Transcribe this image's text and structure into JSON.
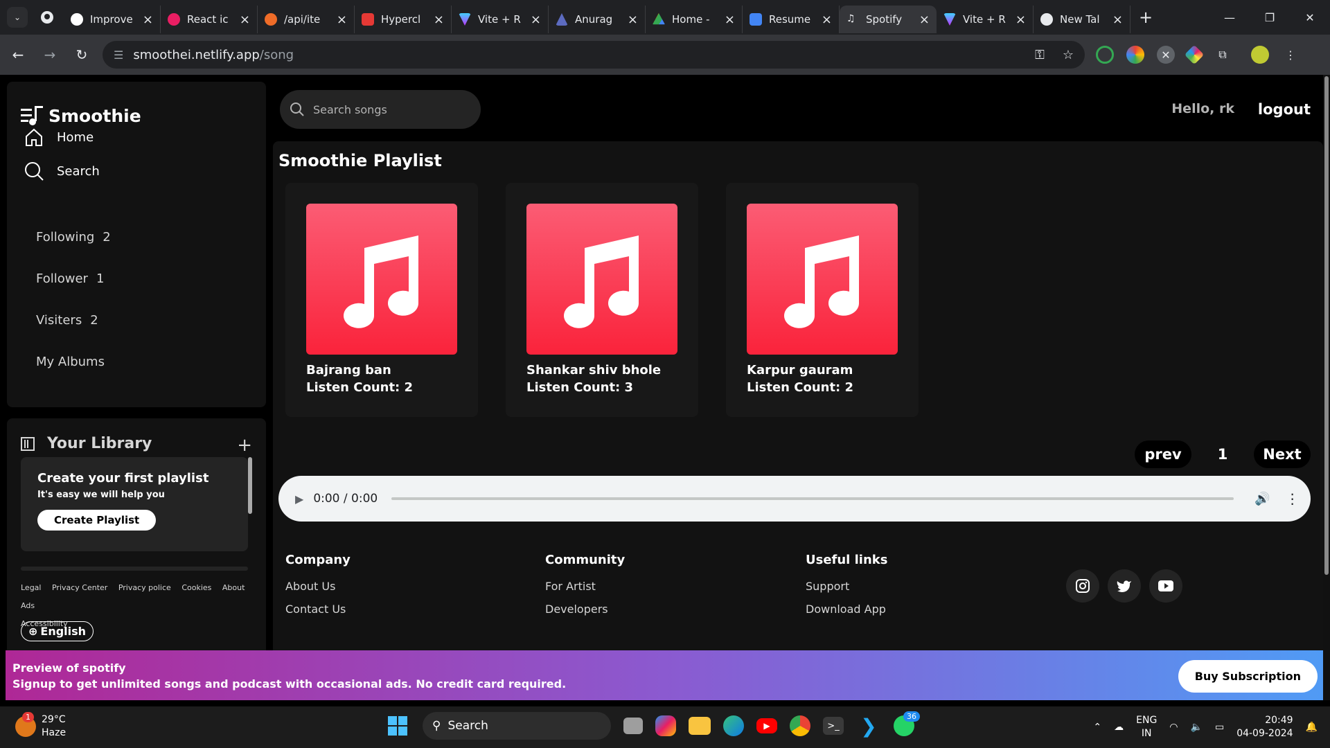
{
  "browser": {
    "tabs": [
      {
        "label": "Improve",
        "color": "#ffffff"
      },
      {
        "label": "React ic",
        "color": "#e91e63"
      },
      {
        "label": "/api/ite",
        "color": "#ef6c28"
      },
      {
        "label": "Hypercl",
        "color": "#e53935"
      },
      {
        "label": "Vite + R",
        "color": "#a56bff"
      },
      {
        "label": "Anurag",
        "color": "#5c6bc0"
      },
      {
        "label": "Home -",
        "color": "#34a853"
      },
      {
        "label": "Resume",
        "color": "#4285f4"
      },
      {
        "label": "Spotify",
        "color": "#e8eaed",
        "active": true
      },
      {
        "label": "Vite + R",
        "color": "#a56bff"
      },
      {
        "label": "New Tal",
        "color": "#e8eaed"
      }
    ],
    "url_host": "smoothei.netlify.app",
    "url_path": "/song"
  },
  "sidebar": {
    "brand": "Smoothie",
    "nav": {
      "home": "Home",
      "search": "Search"
    },
    "stats": [
      {
        "label": "Following",
        "count": "2"
      },
      {
        "label": "Follower",
        "count": "1"
      },
      {
        "label": "Visiters",
        "count": "2"
      }
    ],
    "albums": "My Albums"
  },
  "library": {
    "title": "Your Library",
    "plus": "+",
    "card_title": "Create your first playlist",
    "card_sub": "It's easy we will help you",
    "card_button": "Create Playlist",
    "legal": [
      "Legal",
      "Privacy Center",
      "Privacy police",
      "Cookies",
      "About Ads",
      "Accessibility"
    ],
    "language": "English"
  },
  "header": {
    "search_placeholder": "Search songs",
    "hello": "Hello, rk",
    "logout": "logout"
  },
  "main": {
    "title": "Smoothie Playlist",
    "songs": [
      {
        "name": "Bajrang ban",
        "listen": "Listen Count: 2"
      },
      {
        "name": "Shankar shiv bhole",
        "listen": "Listen Count: 3"
      },
      {
        "name": "Karpur gauram",
        "listen": "Listen Count: 2"
      }
    ],
    "pager": {
      "prev": "prev",
      "page": "1",
      "next": "Next"
    },
    "player": {
      "time": "0:00 / 0:00"
    }
  },
  "footer": {
    "company": {
      "title": "Company",
      "links": [
        "About Us",
        "Contact Us"
      ]
    },
    "community": {
      "title": "Community",
      "links": [
        "For Artist",
        "Developers"
      ]
    },
    "useful": {
      "title": "Useful links",
      "links": [
        "Support",
        "Download App"
      ]
    }
  },
  "banner": {
    "line1": "Preview of spotify",
    "line2": "Signup to get unlimited songs and podcast with occasional ads. No credit card required.",
    "button": "Buy Subscription"
  },
  "taskbar": {
    "weather_temp": "29°C",
    "weather_desc": "Haze",
    "weather_badge": "1",
    "search": "Search",
    "whatsapp_badge": "36",
    "lang1": "ENG",
    "lang2": "IN",
    "time": "20:49",
    "date": "04-09-2024"
  },
  "colors": {
    "accent": "#fa233b",
    "banner_start": "#af2896",
    "banner_end": "#509bf5"
  }
}
